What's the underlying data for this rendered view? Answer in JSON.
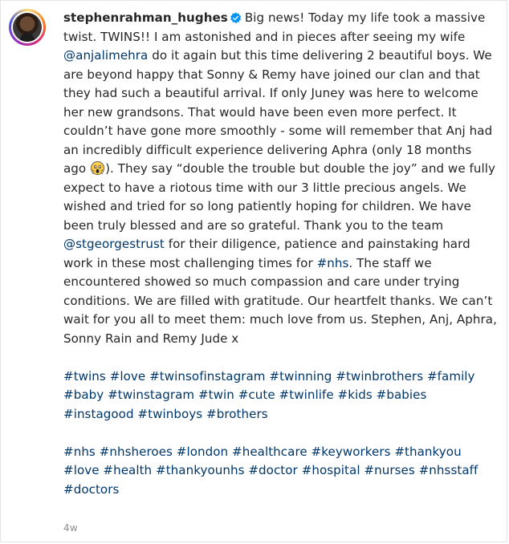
{
  "post": {
    "username": "stephenrahman_hughes",
    "verified_icon": "verified-badge-icon",
    "caption": {
      "t1": "Big news! Today my life took a massive twist. TWINS!! I am astonished and in pieces after seeing my wife ",
      "mention1": "@anjalimehra",
      "t2": " do it again but this time delivering 2 beautiful boys. We are beyond happy that Sonny & Remy have joined our clan and that they had such a beautiful arrival. If only Juney was here to welcome her new grandsons. That would have been even more perfect. It couldn’t have gone more smoothly - some will remember that Anj had an incredibly difficult experience delivering Aphra (only 18 months ago ",
      "emoji": "face-screaming-in-fear-emoji",
      "t3": "). They say “double the trouble but double the joy” and we fully expect to have a riotous time with our 3 little precious angels. We wished and tried for so long patiently hoping for children. We have been truly blessed and are so grateful. Thank you to the team ",
      "mention2": "@stgeorgestrust",
      "t4": " for their diligence, patience and painstaking hard work in these most challenging times for ",
      "hashtag_nhs": "#nhs",
      "t5": ". The staff we encountered showed so much compassion and care under trying conditions. We are filled with gratitude. Our heartfelt thanks. We can’t wait for you all to meet them: much love from us. Stephen, Anj, Aphra, Sonny Rain and Remy Jude x"
    },
    "hashtags_1": "#twins #love #twinsofinstagram #twinning #twinbrothers #family #baby #twinstagram #twin #cute #twinlife #kids #babies #instagood #twinboys #brothers",
    "hashtags_2": "#nhs #nhsheroes #london #healthcare #keyworkers #thankyou #love #health #thankyounhs #doctor #hospital #nurses #nhsstaff #doctors",
    "timestamp": "4w"
  },
  "colors": {
    "link": "#00376b",
    "text": "#262626",
    "verified": "#0095f6",
    "timestamp": "#8e8e8e"
  }
}
